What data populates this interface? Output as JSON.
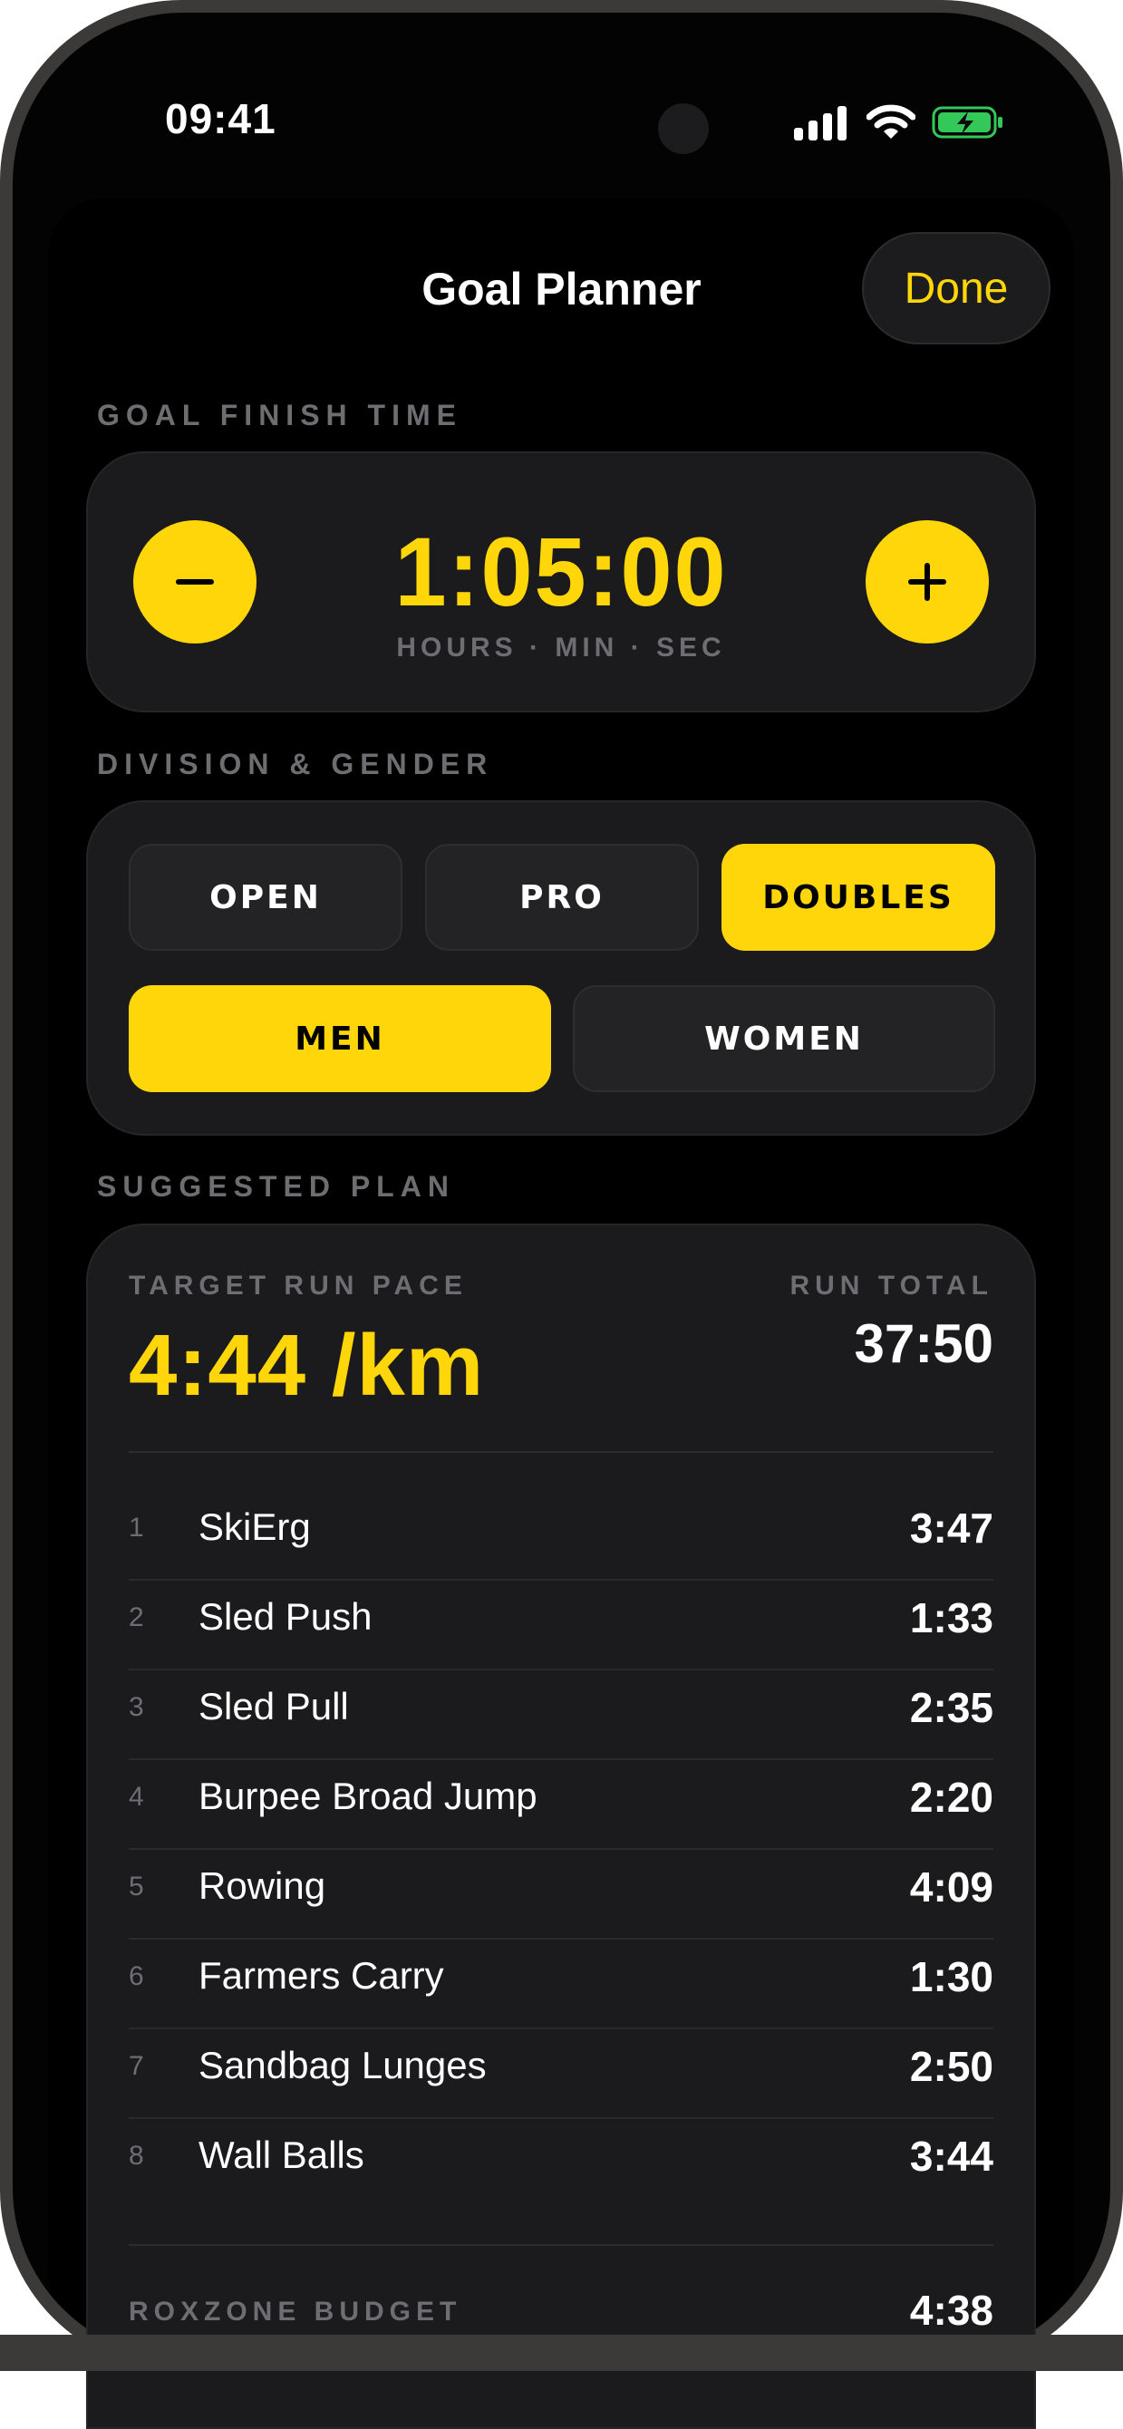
{
  "status_bar": {
    "time": "09:41"
  },
  "nav": {
    "title": "Goal Planner",
    "done_label": "Done"
  },
  "goal_section": {
    "label": "GOAL FINISH TIME",
    "time": "1:05:00",
    "units": "HOURS · MIN · SEC",
    "minus_symbol": "−",
    "plus_symbol": "+"
  },
  "division_section": {
    "label": "DIVISION & GENDER",
    "divisions": [
      "OPEN",
      "PRO",
      "DOUBLES"
    ],
    "selected_division": "DOUBLES",
    "genders": [
      "MEN",
      "WOMEN"
    ],
    "selected_gender": "MEN"
  },
  "plan_section": {
    "label": "SUGGESTED PLAN",
    "target_pace_label": "TARGET RUN PACE",
    "target_pace": "4:44 /km",
    "run_total_label": "RUN TOTAL",
    "run_total": "37:50",
    "stations": [
      {
        "num": "1",
        "name": "SkiErg",
        "time": "3:47"
      },
      {
        "num": "2",
        "name": "Sled Push",
        "time": "1:33"
      },
      {
        "num": "3",
        "name": "Sled Pull",
        "time": "2:35"
      },
      {
        "num": "4",
        "name": "Burpee Broad Jump",
        "time": "2:20"
      },
      {
        "num": "5",
        "name": "Rowing",
        "time": "4:09"
      },
      {
        "num": "6",
        "name": "Farmers Carry",
        "time": "1:30"
      },
      {
        "num": "7",
        "name": "Sandbag Lunges",
        "time": "2:50"
      },
      {
        "num": "8",
        "name": "Wall Balls",
        "time": "3:44"
      }
    ],
    "roxzone_label": "ROXZONE BUDGET",
    "roxzone_time": "4:38"
  },
  "colors": {
    "accent": "#ffd60a",
    "background": "#000000",
    "card": "#1b1b1d",
    "muted": "#6e6e72",
    "battery": "#34c759"
  }
}
